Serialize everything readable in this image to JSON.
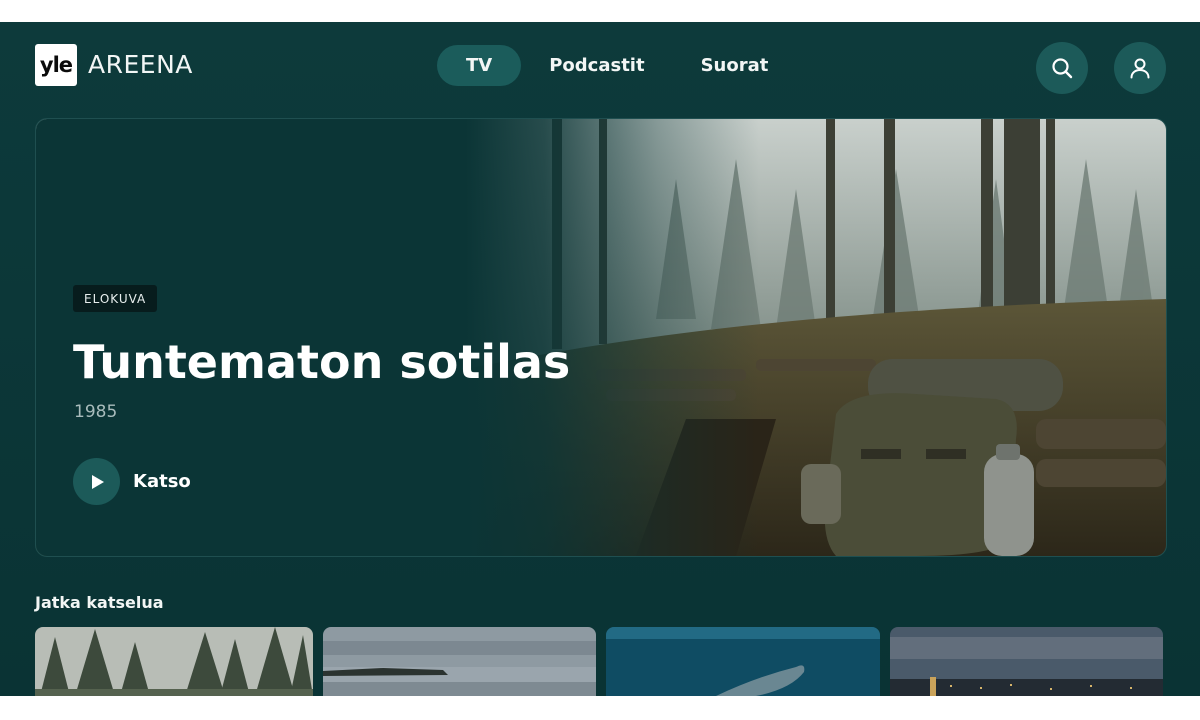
{
  "header": {
    "logo_mark": "yle",
    "logo_text": "AREENA",
    "tabs": [
      {
        "label": "TV",
        "active": true
      },
      {
        "label": "Podcastit",
        "active": false
      },
      {
        "label": "Suorat",
        "active": false
      }
    ],
    "search_icon": "search-icon",
    "profile_icon": "user-icon"
  },
  "hero": {
    "badge": "ELOKUVA",
    "title": "Tuntematon sotilas",
    "year": "1985",
    "play_label": "Katso"
  },
  "continue_row": {
    "title": "Jatka katselua",
    "cards": [
      {
        "image": "misty-forest"
      },
      {
        "image": "lake-shore"
      },
      {
        "image": "underwater-whale"
      },
      {
        "image": "city-dusk"
      }
    ]
  },
  "colors": {
    "background": "#0d3a3b",
    "accent": "#1c5a59",
    "text": "#ffffff"
  }
}
